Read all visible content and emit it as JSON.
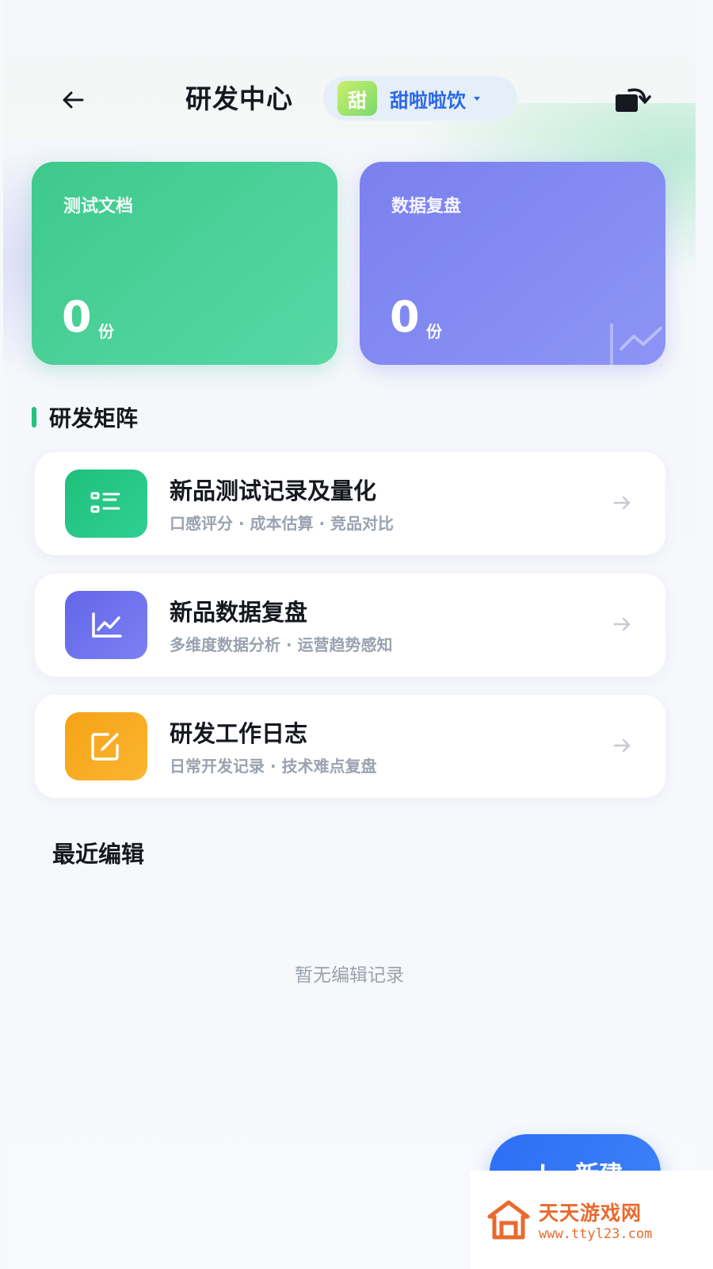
{
  "header": {
    "title": "研发中心",
    "brand_badge": "甜",
    "brand_name": "甜啦啦饮"
  },
  "stats": [
    {
      "label": "测试文档",
      "value": "0",
      "unit": "份"
    },
    {
      "label": "数据复盘",
      "value": "0",
      "unit": "份"
    }
  ],
  "matrix": {
    "title": "研发矩阵",
    "items": [
      {
        "title": "新品测试记录及量化",
        "subtitle": "口感评分 · 成本估算 · 竞品对比",
        "icon": "list-icon",
        "color": "#22c27e"
      },
      {
        "title": "新品数据复盘",
        "subtitle": "多维度数据分析 · 运营趋势感知",
        "icon": "trend-chart-icon",
        "color": "#6c6fe8"
      },
      {
        "title": "研发工作日志",
        "subtitle": "日常开发记录 · 技术难点复盘",
        "icon": "edit-icon",
        "color": "#f6a51a"
      }
    ]
  },
  "recent": {
    "title": "最近编辑",
    "empty_text": "暂无编辑记录"
  },
  "fab": {
    "plus": "+",
    "label": "新建"
  },
  "watermark": {
    "name": "天天游戏网",
    "url": "www.ttyl23.com"
  }
}
